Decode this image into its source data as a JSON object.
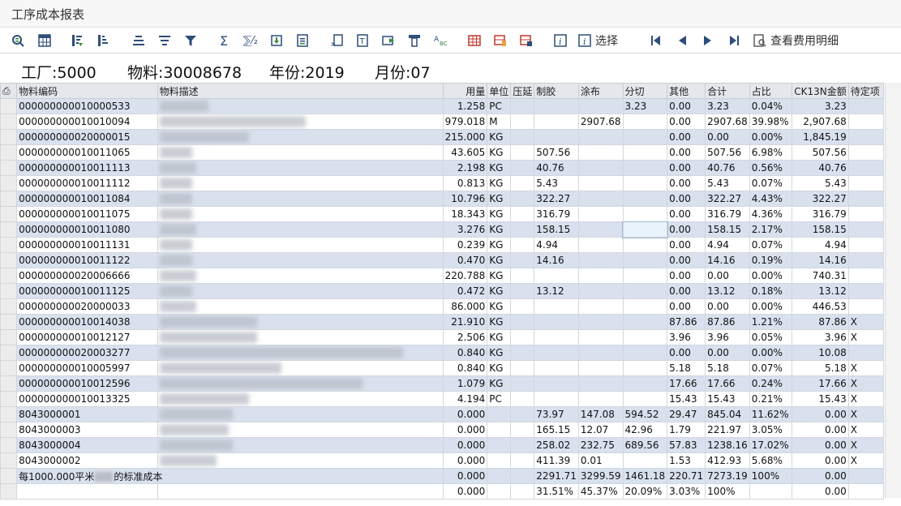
{
  "app": {
    "title": "工序成本报表"
  },
  "toolbar": {
    "buttons": [
      {
        "icon": "details-icon"
      },
      {
        "icon": "spreadsheet-icon"
      },
      {
        "icon": "sort-ascending-icon"
      },
      {
        "icon": "sort-descending-icon"
      },
      {
        "icon": "align-center-icon"
      },
      {
        "icon": "filter-lines-icon"
      },
      {
        "icon": "filter-icon"
      },
      {
        "icon": "sum-icon"
      },
      {
        "icon": "subtotal-icon"
      },
      {
        "icon": "export-icon"
      },
      {
        "icon": "print-preview-icon"
      },
      {
        "icon": "word-export-icon"
      },
      {
        "icon": "text-icon"
      },
      {
        "icon": "send-icon"
      },
      {
        "icon": "layout-icon"
      },
      {
        "icon": "abc-icon"
      },
      {
        "icon": "grid-icon"
      },
      {
        "icon": "choose-layout-icon"
      },
      {
        "icon": "save-layout-icon"
      },
      {
        "icon": "info-icon"
      }
    ],
    "select_label": "选择",
    "view_expense_label": "查看费用明细"
  },
  "header": {
    "plant": "工厂:5000",
    "material": "物料:30008678",
    "year": "年份:2019",
    "month": "月份:07"
  },
  "table": {
    "columns": [
      "物料编码",
      "物料描述",
      "用量",
      "单位",
      "压延",
      "制胶",
      "涂布",
      "分切",
      "其他",
      "合计",
      "占比",
      "CK13N金额",
      "待定项"
    ],
    "rows": [
      [
        "000000000010000533",
        "",
        "1.258",
        "PC",
        "",
        "",
        "",
        "3.23",
        "0.00",
        "3.23",
        "0.04%",
        "3.23",
        ""
      ],
      [
        "000000000010010094",
        "",
        "979.018",
        "M",
        "",
        "",
        "2907.68",
        "",
        "0.00",
        "2907.68",
        "39.98%",
        "2,907.68",
        ""
      ],
      [
        "000000000020000015",
        "",
        "215.000",
        "KG",
        "",
        "",
        "",
        "",
        "0.00",
        "0.00",
        "0.00%",
        "1,845.19",
        ""
      ],
      [
        "000000000010011065",
        "",
        "43.605",
        "KG",
        "",
        "507.56",
        "",
        "",
        "0.00",
        "507.56",
        "6.98%",
        "507.56",
        ""
      ],
      [
        "000000000010011113",
        "",
        "2.198",
        "KG",
        "",
        "40.76",
        "",
        "",
        "0.00",
        "40.76",
        "0.56%",
        "40.76",
        ""
      ],
      [
        "000000000010011112",
        "",
        "0.813",
        "KG",
        "",
        "5.43",
        "",
        "",
        "0.00",
        "5.43",
        "0.07%",
        "5.43",
        ""
      ],
      [
        "000000000010011084",
        "",
        "10.796",
        "KG",
        "",
        "322.27",
        "",
        "",
        "0.00",
        "322.27",
        "4.43%",
        "322.27",
        ""
      ],
      [
        "000000000010011075",
        "",
        "18.343",
        "KG",
        "",
        "316.79",
        "",
        "",
        "0.00",
        "316.79",
        "4.36%",
        "316.79",
        ""
      ],
      [
        "000000000010011080",
        "",
        "3.276",
        "KG",
        "",
        "158.15",
        "",
        "",
        "0.00",
        "158.15",
        "2.17%",
        "158.15",
        ""
      ],
      [
        "000000000010011131",
        "",
        "0.239",
        "KG",
        "",
        "4.94",
        "",
        "",
        "0.00",
        "4.94",
        "0.07%",
        "4.94",
        ""
      ],
      [
        "000000000010011122",
        "",
        "0.470",
        "KG",
        "",
        "14.16",
        "",
        "",
        "0.00",
        "14.16",
        "0.19%",
        "14.16",
        ""
      ],
      [
        "000000000020006666",
        "",
        "220.788",
        "KG",
        "",
        "",
        "",
        "",
        "0.00",
        "0.00",
        "0.00%",
        "740.31",
        ""
      ],
      [
        "000000000010011125",
        "",
        "0.472",
        "KG",
        "",
        "13.12",
        "",
        "",
        "0.00",
        "13.12",
        "0.18%",
        "13.12",
        ""
      ],
      [
        "000000000020000033",
        "",
        "86.000",
        "KG",
        "",
        "",
        "",
        "",
        "0.00",
        "0.00",
        "0.00%",
        "446.53",
        ""
      ],
      [
        "000000000010014038",
        "",
        "21.910",
        "KG",
        "",
        "",
        "",
        "",
        "87.86",
        "87.86",
        "1.21%",
        "87.86",
        "X"
      ],
      [
        "000000000010012127",
        "",
        "2.506",
        "KG",
        "",
        "",
        "",
        "",
        "3.96",
        "3.96",
        "0.05%",
        "3.96",
        "X"
      ],
      [
        "000000000020003277",
        "",
        "0.840",
        "KG",
        "",
        "",
        "",
        "",
        "0.00",
        "0.00",
        "0.00%",
        "10.08",
        ""
      ],
      [
        "000000000010005997",
        "",
        "0.840",
        "KG",
        "",
        "",
        "",
        "",
        "5.18",
        "5.18",
        "0.07%",
        "5.18",
        "X"
      ],
      [
        "000000000010012596",
        "",
        "1.079",
        "KG",
        "",
        "",
        "",
        "",
        "17.66",
        "17.66",
        "0.24%",
        "17.66",
        "X"
      ],
      [
        "000000000010013325",
        "",
        "4.194",
        "PC",
        "",
        "",
        "",
        "",
        "15.43",
        "15.43",
        "0.21%",
        "15.43",
        "X"
      ],
      [
        "8043000001",
        "",
        "0.000",
        "",
        "",
        "73.97",
        "147.08",
        "594.52",
        "29.47",
        "845.04",
        "11.62%",
        "0.00",
        "X"
      ],
      [
        "8043000003",
        "",
        "0.000",
        "",
        "",
        "165.15",
        "12.07",
        "42.96",
        "1.79",
        "221.97",
        "3.05%",
        "0.00",
        "X"
      ],
      [
        "8043000004",
        "",
        "0.000",
        "",
        "",
        "258.02",
        "232.75",
        "689.56",
        "57.83",
        "1238.16",
        "17.02%",
        "0.00",
        "X"
      ],
      [
        "8043000002",
        "",
        "0.000",
        "",
        "",
        "411.39",
        "0.01",
        "",
        "1.53",
        "412.93",
        "5.68%",
        "0.00",
        "X"
      ],
      [
        "每1000.000平米",
        "",
        "0.000",
        "",
        "",
        "2291.71",
        "3299.59",
        "1461.18",
        "220.71",
        "7273.19",
        "100%",
        "0.00",
        ""
      ],
      [
        "",
        "",
        "0.000",
        "",
        "",
        "31.51%",
        "45.37%",
        "20.09%",
        "3.03%",
        "100%",
        "",
        "0.00",
        ""
      ]
    ],
    "summary_suffix": "的标准成本"
  }
}
